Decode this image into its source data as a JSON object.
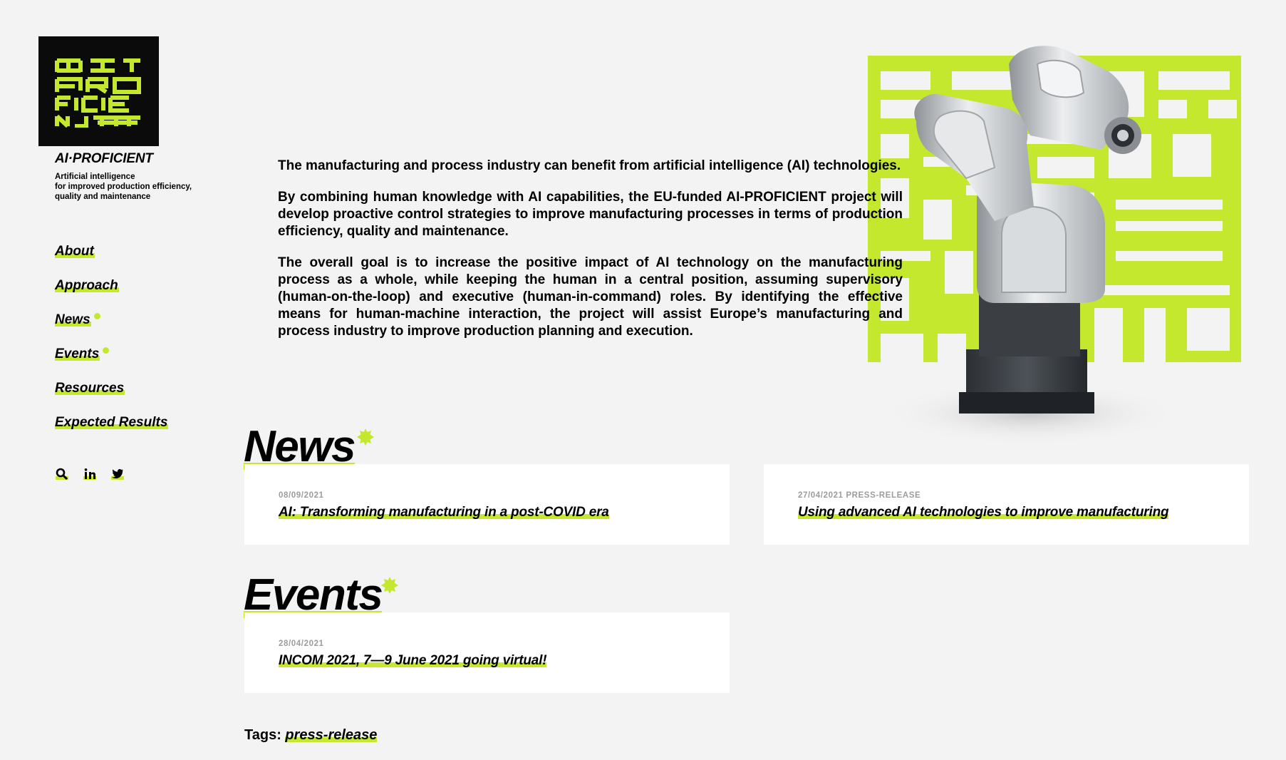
{
  "brand": {
    "name": "AI·PROFICIENT",
    "tagline": [
      "Artificial intelligence",
      "for improved production efficiency,",
      "quality and maintenance"
    ]
  },
  "nav": [
    {
      "label": "About",
      "dot": false
    },
    {
      "label": "Approach",
      "dot": false
    },
    {
      "label": "News",
      "dot": true
    },
    {
      "label": "Events",
      "dot": true
    },
    {
      "label": "Resources",
      "dot": false
    },
    {
      "label": "Expected Results",
      "dot": false
    }
  ],
  "social_icons": [
    "search-icon",
    "linkedin-icon",
    "twitter-icon"
  ],
  "intro": [
    "The manufacturing and process industry can benefit from artificial intelligence (AI) technologies.",
    "By combining human knowledge with AI capabilities, the EU-funded AI-PROFICIENT project will develop proactive control strategies to improve manufacturing processes in terms of production efficiency, quality and maintenance.",
    "The overall goal is to increase the positive impact of AI technology on the manufacturing process as a whole, while keeping the human in a central position, assuming supervisory (human-on-the-loop) and executive (human-in-command) roles. By identifying the effective means for human-machine interaction, the project will assist Europe’s manufacturing and process industry to improve production planning and execution."
  ],
  "news": {
    "title": "News",
    "items": [
      {
        "meta": "08/09/2021",
        "title": "AI: Transforming manufacturing in a post-COVID era"
      },
      {
        "meta": "27/04/2021 PRESS-RELEASE",
        "title": "Using advanced AI technologies to improve manufacturing"
      }
    ]
  },
  "events": {
    "title": "Events",
    "items": [
      {
        "meta": "28/04/2021",
        "title": "INCOM 2021, 7—9 June 2021 going virtual!"
      }
    ]
  },
  "tags": {
    "label": "Tags:",
    "tag": "press-release"
  },
  "colors": {
    "accent": "#c3e82d",
    "background": "#f3f3f3",
    "logo_bg": "#0b0b0b"
  }
}
